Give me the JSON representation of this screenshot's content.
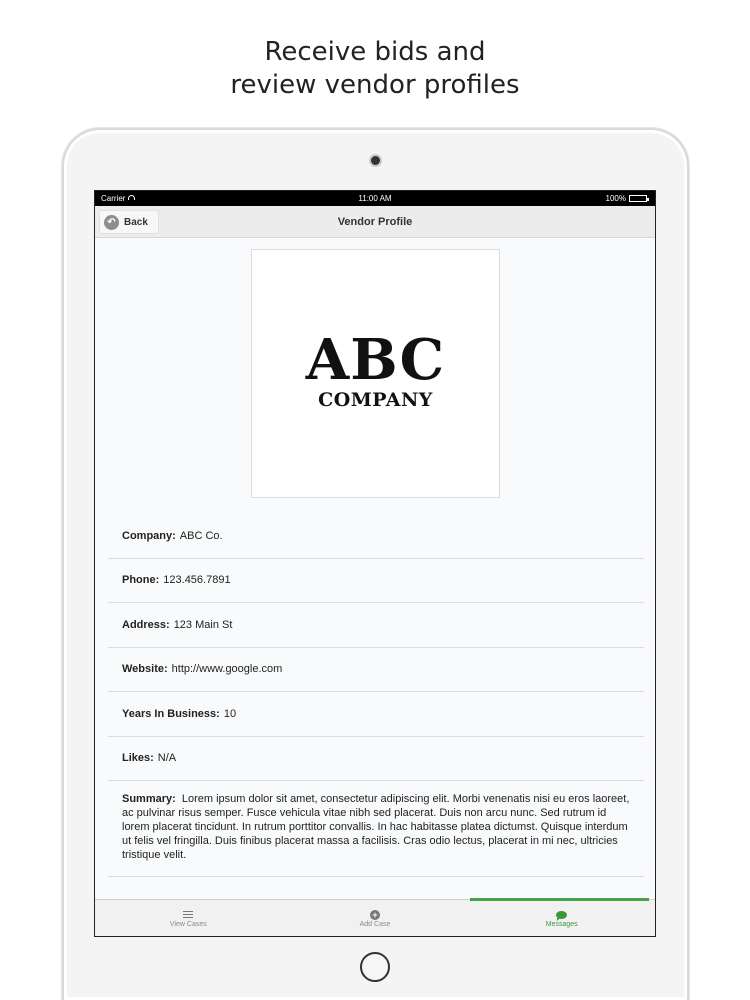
{
  "headline": {
    "line1": "Receive bids and",
    "line2": "review vendor profiles"
  },
  "status_bar": {
    "carrier": "Carrier",
    "time": "11:00 AM",
    "battery": "100%"
  },
  "nav_bar": {
    "back_label": "Back",
    "title": "Vendor Profile"
  },
  "logo": {
    "main_text": "ABC",
    "sub_text": "COMPANY"
  },
  "profile_fields": [
    {
      "label": "Company:",
      "value": "ABC Co."
    },
    {
      "label": "Phone:",
      "value": "123.456.7891"
    },
    {
      "label": "Address:",
      "value": "123 Main St"
    },
    {
      "label": "Website:",
      "value": "http://www.google.com"
    },
    {
      "label": "Years In Business:",
      "value": "10"
    },
    {
      "label": "Likes:",
      "value": "N/A"
    }
  ],
  "summary": {
    "label": "Summary:",
    "text": "Lorem ipsum dolor sit amet, consectetur adipiscing elit. Morbi venenatis nisi eu eros laoreet, ac pulvinar risus semper. Fusce vehicula vitae nibh sed placerat. Duis non arcu nunc. Sed rutrum id lorem placerat tincidunt. In rutrum porttitor convallis. In hac habitasse platea dictumst. Quisque interdum ut felis vel fringilla. Duis finibus placerat massa a facilisis. Cras odio lectus, placerat in mi nec, ultricies tristique velit."
  },
  "tab_bar": {
    "tabs": [
      {
        "label": "View Cases",
        "icon": "menu-icon",
        "active": false
      },
      {
        "label": "Add Case",
        "icon": "add-circle-icon",
        "active": false
      },
      {
        "label": "Messages",
        "icon": "chat-bubble-icon",
        "active": true
      }
    ],
    "active_color": "#45a04a"
  }
}
